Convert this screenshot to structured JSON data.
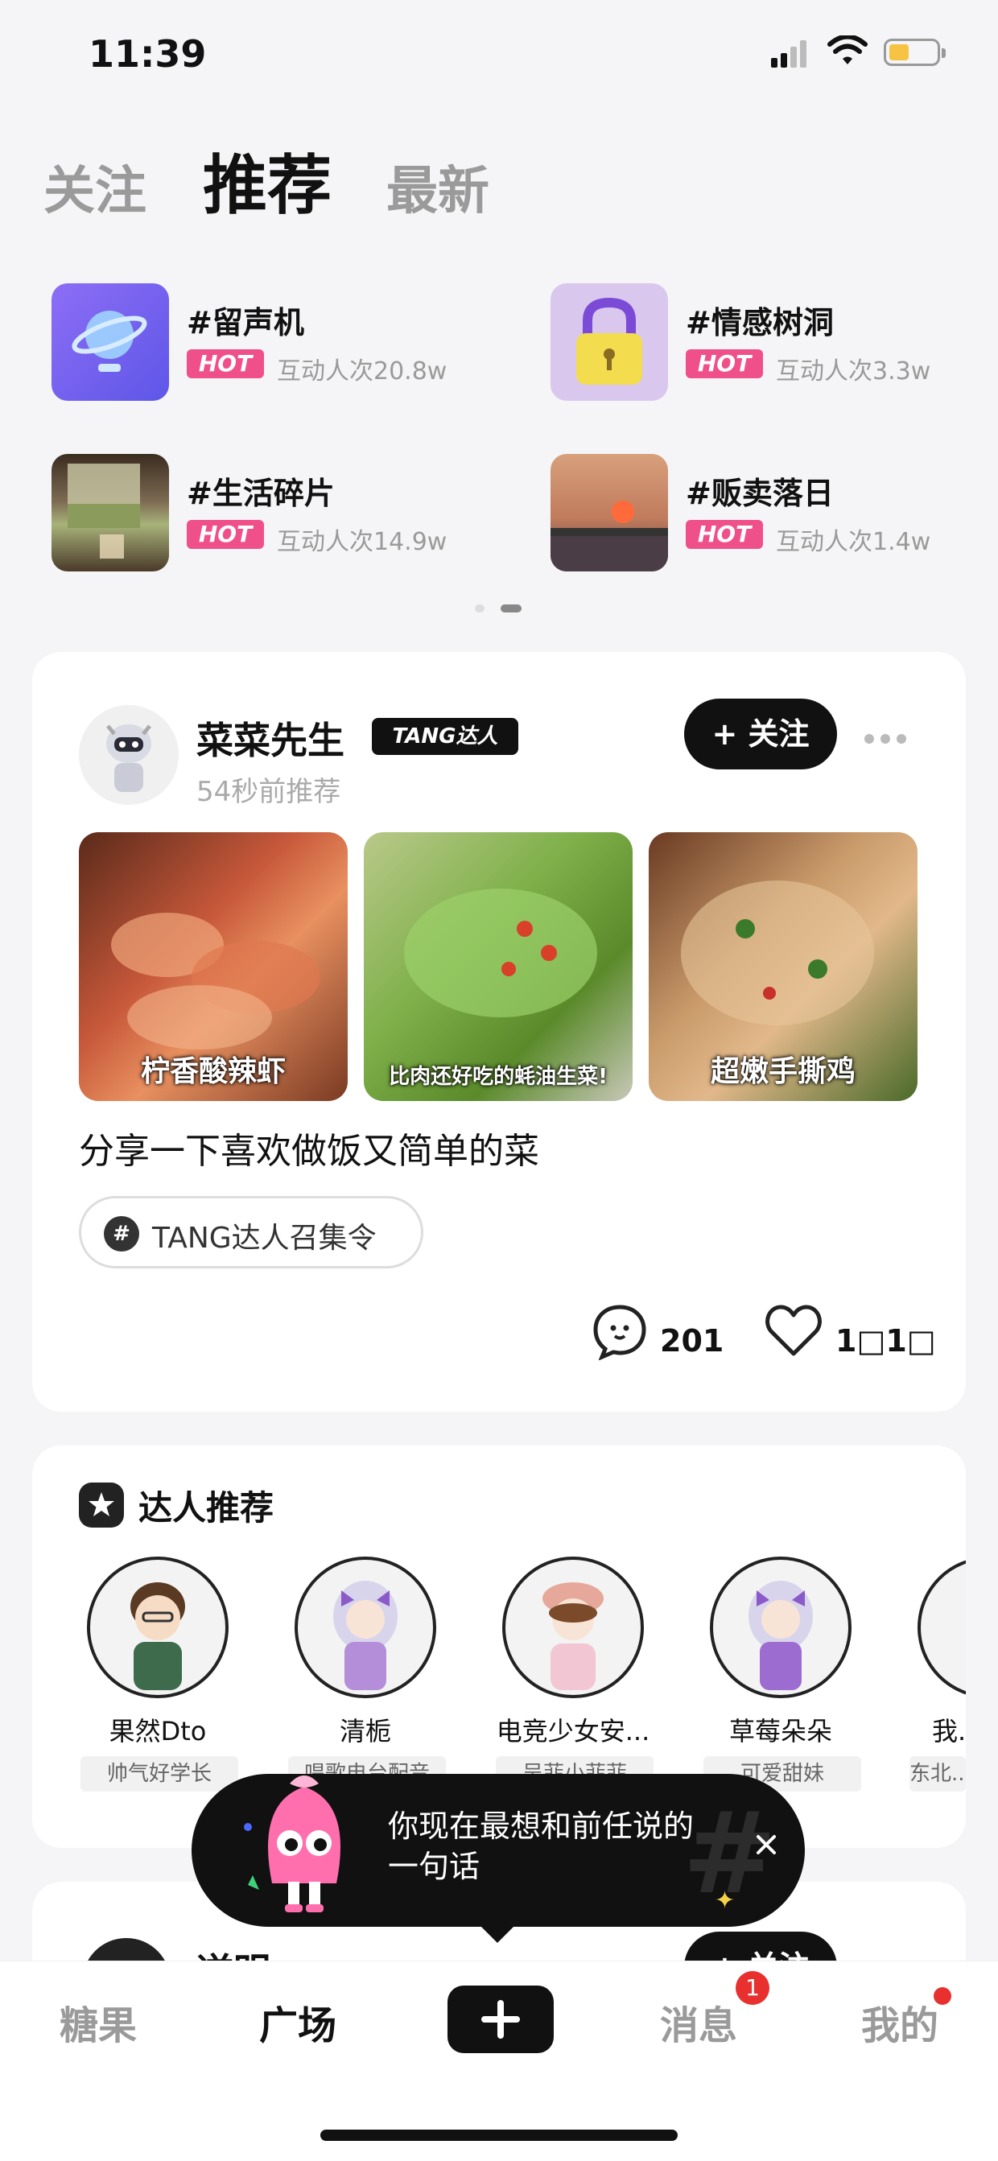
{
  "status_bar": {
    "time": "11:39"
  },
  "top_tabs": [
    {
      "label": "关注"
    },
    {
      "label": "推荐"
    },
    {
      "label": "最新"
    }
  ],
  "topics": [
    {
      "title": "#留声机",
      "badge": "HOT",
      "stat": "互动人次20.8w"
    },
    {
      "title": "#情感树洞",
      "badge": "HOT",
      "stat": "互动人次3.3w"
    },
    {
      "title": "#生活碎片",
      "badge": "HOT",
      "stat": "互动人次14.9w"
    },
    {
      "title": "#贩卖落日",
      "badge": "HOT",
      "stat": "互动人次1.4w"
    }
  ],
  "post": {
    "username": "菜菜先生",
    "badge": "TANG达人",
    "time": "54秒前推荐",
    "follow_label": "+ 关注",
    "photos": [
      {
        "caption": "柠香酸辣虾"
      },
      {
        "caption": "比肉还好吃的蚝油生菜!"
      },
      {
        "caption": "超嫩手撕鸡"
      }
    ],
    "text": "分享一下喜欢做饭又简单的菜",
    "tag": "TANG达人召集令",
    "comments": "201",
    "likes": "1□1□"
  },
  "experts_section": {
    "title": "达人推荐",
    "experts": [
      {
        "name": "果然Dto",
        "tag": "帅气好学长"
      },
      {
        "name": "清栀",
        "tag": "唱歌电台配音"
      },
      {
        "name": "电竞少女安...",
        "tag": "吴菲小菲菲"
      },
      {
        "name": "草莓朵朵",
        "tag": "可爱甜妹"
      },
      {
        "name": "我...",
        "tag": "东北..."
      }
    ]
  },
  "next_post": {
    "username": "逆明",
    "follow_label": "+ 关注"
  },
  "tooltip": {
    "line1": "你现在最想和前任说的",
    "line2": "一句话"
  },
  "bottom_nav": {
    "items": [
      {
        "label": "糖果"
      },
      {
        "label": "广场"
      },
      {
        "label": "消息",
        "badge": "1"
      },
      {
        "label": "我的"
      }
    ]
  },
  "colors": {
    "hot": "#f0508a",
    "accent": "#111111",
    "badge_red": "#e8312f"
  }
}
